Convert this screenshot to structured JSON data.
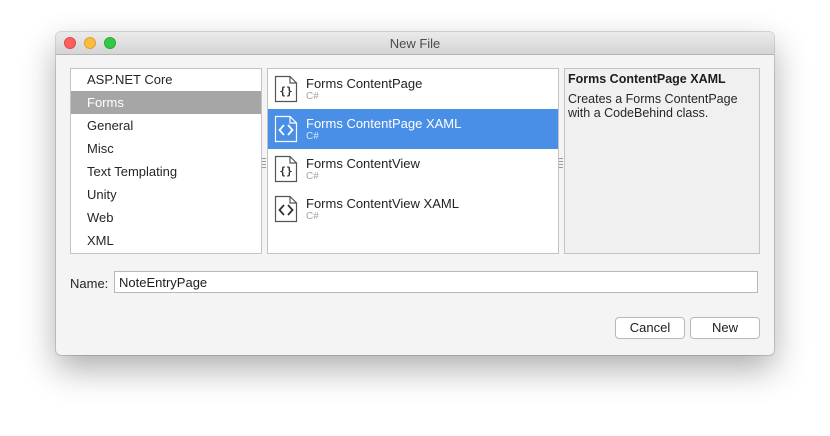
{
  "window": {
    "title": "New File"
  },
  "categories": {
    "items": [
      {
        "label": "ASP.NET Core",
        "selected": false
      },
      {
        "label": "Forms",
        "selected": true
      },
      {
        "label": "General",
        "selected": false
      },
      {
        "label": "Misc",
        "selected": false
      },
      {
        "label": "Text Templating",
        "selected": false
      },
      {
        "label": "Unity",
        "selected": false
      },
      {
        "label": "Web",
        "selected": false
      },
      {
        "label": "XML",
        "selected": false
      }
    ]
  },
  "templates": {
    "items": [
      {
        "name": "Forms ContentPage",
        "lang": "C#",
        "icon": "curly-braces-file-icon",
        "selected": false
      },
      {
        "name": "Forms ContentPage XAML",
        "lang": "C#",
        "icon": "angle-brackets-file-icon",
        "selected": true
      },
      {
        "name": "Forms ContentView",
        "lang": "C#",
        "icon": "curly-braces-file-icon",
        "selected": false
      },
      {
        "name": "Forms ContentView XAML",
        "lang": "C#",
        "icon": "angle-brackets-file-icon",
        "selected": false
      }
    ]
  },
  "description": {
    "title": "Forms ContentPage XAML",
    "body": "Creates a Forms ContentPage with a CodeBehind class."
  },
  "name_field": {
    "label": "Name:",
    "value": "NoteEntryPage"
  },
  "buttons": {
    "cancel": "Cancel",
    "new": "New"
  },
  "colors": {
    "selection_blue": "#4a8fe7",
    "category_selected": "#a6a6a6"
  }
}
